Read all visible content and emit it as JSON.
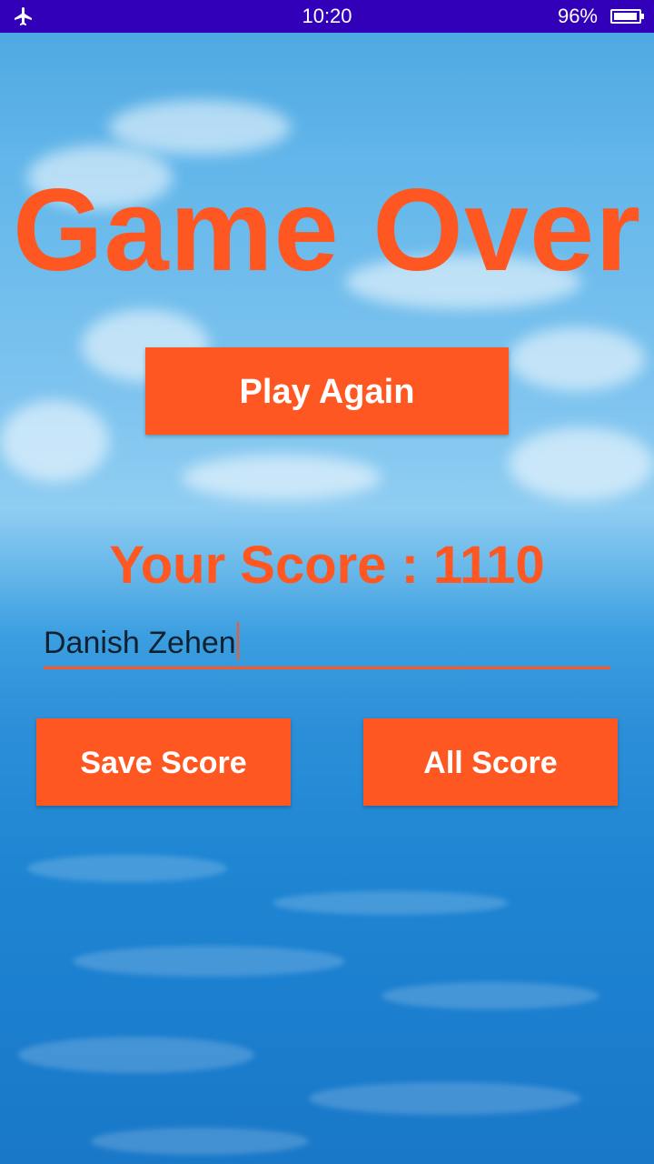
{
  "status_bar": {
    "time": "10:20",
    "battery_percent_text": "96%",
    "battery_level": 0.96,
    "airplane_icon": "airplane-icon",
    "background_color": "#3100b8"
  },
  "game_over": {
    "title": "Game Over",
    "play_again_label": "Play Again",
    "score_text": "Your Score : 1110",
    "name_value": "Danish Zehen",
    "save_score_label": "Save Score",
    "all_score_label": "All Score"
  },
  "colors": {
    "accent": "#ff5722",
    "button_text": "#ffffff"
  }
}
